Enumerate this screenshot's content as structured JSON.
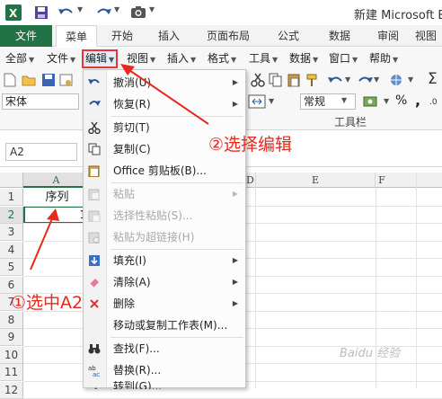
{
  "titlebar": {
    "title": "新建 Microsoft E"
  },
  "ribbon": {
    "tabs": [
      "文件",
      "菜单",
      "开始",
      "插入",
      "页面布局",
      "公式",
      "数据",
      "审阅",
      "视图"
    ]
  },
  "menubar": {
    "items": [
      "全部",
      "文件",
      "编辑",
      "视图",
      "插入",
      "格式",
      "工具",
      "数据",
      "窗口",
      "帮助"
    ]
  },
  "toolbar": {
    "font_name": "宋体",
    "number_format": "常规",
    "group_label": "工具栏",
    "percent": "%",
    "comma": ","
  },
  "formula_bar": {
    "name_box": "A2"
  },
  "grid": {
    "columns": [
      "A",
      "D",
      "E",
      "F"
    ],
    "rows": [
      "1",
      "2",
      "3",
      "4",
      "5",
      "6",
      "7",
      "8",
      "9",
      "10",
      "11",
      "12"
    ],
    "a1_value": "序列",
    "a2_partial": "1"
  },
  "edit_menu": {
    "items": [
      {
        "label": "撤消(U)",
        "icon": "undo-icon",
        "disabled": false,
        "submenu": true
      },
      {
        "label": "恢复(R)",
        "icon": "redo-icon",
        "disabled": false,
        "submenu": true
      },
      {
        "label": "剪切(T)",
        "icon": "scissors-icon",
        "disabled": false,
        "submenu": false
      },
      {
        "label": "复制(C)",
        "icon": "copy-icon",
        "disabled": false,
        "submenu": false
      },
      {
        "label": "Office 剪贴板(B)...",
        "icon": "clipboard-icon",
        "disabled": false,
        "submenu": false
      },
      {
        "label": "粘贴",
        "icon": "paste-icon",
        "disabled": true,
        "submenu": true
      },
      {
        "label": "选择性粘贴(S)...",
        "icon": "paste-special-icon",
        "disabled": true,
        "submenu": false
      },
      {
        "label": "粘贴为超链接(H)",
        "icon": "paste-link-icon",
        "disabled": true,
        "submenu": false
      },
      {
        "label": "填充(I)",
        "icon": "fill-down-icon",
        "disabled": false,
        "submenu": true
      },
      {
        "label": "清除(A)",
        "icon": "eraser-icon",
        "disabled": false,
        "submenu": true
      },
      {
        "label": "删除",
        "icon": "delete-icon",
        "disabled": false,
        "submenu": true
      },
      {
        "label": "移动或复制工作表(M)...",
        "icon": "",
        "disabled": false,
        "submenu": false
      },
      {
        "label": "查找(F)...",
        "icon": "binoculars-icon",
        "disabled": false,
        "submenu": false
      },
      {
        "label": "替换(R)...",
        "icon": "replace-icon",
        "disabled": false,
        "submenu": false
      },
      {
        "label": "转到(G)...",
        "icon": "goto-icon",
        "disabled": false,
        "submenu": false
      }
    ]
  },
  "annotations": {
    "step1": "①选中A2",
    "step2": "②选择编辑"
  },
  "watermark": "Baidu 经验",
  "colors": {
    "excel_green": "#217346",
    "annotation_red": "#e8281e"
  }
}
